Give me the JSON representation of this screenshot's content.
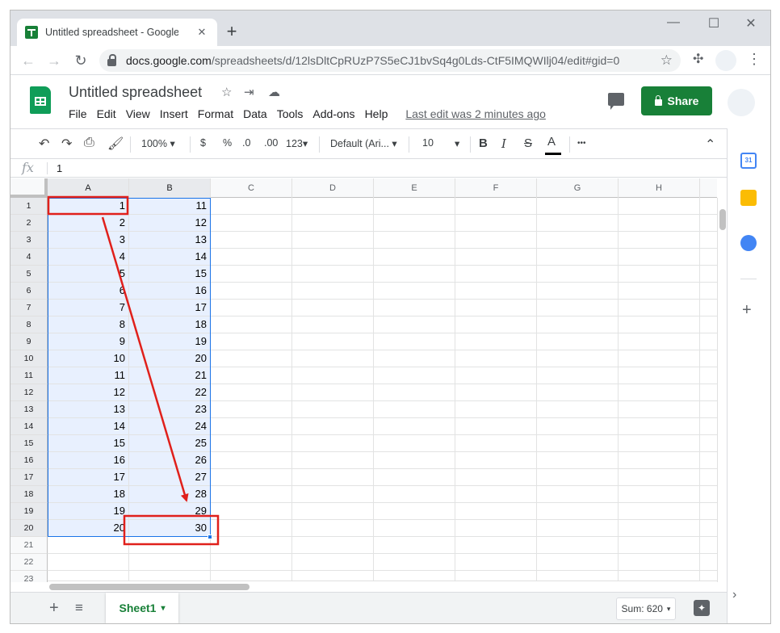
{
  "browser": {
    "tab_title": "Untitled spreadsheet - Google Sheets",
    "tab_close": "✕",
    "new_tab": "+",
    "window_controls": {
      "minimize": "—",
      "maximize": "☐",
      "close": "✕"
    },
    "url_host": "docs.google.com",
    "url_path": "/spreadsheets/d/12lsDltCpRUzP7S5eCJ1bvSq4g0Lds-CtF5IMQWIlj04/edit#gid=0",
    "back": "←",
    "forward": "→",
    "reload": "↻",
    "bookmark": "☆",
    "extensions": "✣",
    "menu": "⋮"
  },
  "app": {
    "doc_title": "Untitled spreadsheet",
    "title_icons": {
      "star": "☆",
      "move": "⇥",
      "cloud": "☁"
    },
    "menu": [
      "File",
      "Edit",
      "View",
      "Insert",
      "Format",
      "Data",
      "Tools",
      "Add-ons",
      "Help"
    ],
    "last_edit": "Last edit was 2 minutes ago",
    "share_label": "Share"
  },
  "toolbar": {
    "undo": "↶",
    "redo": "↷",
    "print": "⎙",
    "paint_format": "🖌",
    "zoom": "100%",
    "caret": "▾",
    "currency": "$",
    "percent": "%",
    "dec_decrease": ".0",
    "dec_increase": ".00",
    "more_formats": "123",
    "font": "Default (Ari...",
    "font_size": "10",
    "bold": "B",
    "italic": "I",
    "strike": "S",
    "text_color": "A",
    "more": "•••",
    "collapse": "⌃"
  },
  "formula_bar": {
    "fx": "fx",
    "value": "1"
  },
  "grid": {
    "columns": [
      "A",
      "B",
      "C",
      "D",
      "E",
      "F",
      "G",
      "H"
    ],
    "rows": [
      "1",
      "2",
      "3",
      "4",
      "5",
      "6",
      "7",
      "8",
      "9",
      "10",
      "11",
      "12",
      "13",
      "14",
      "15",
      "16",
      "17",
      "18",
      "19",
      "20",
      "21",
      "22",
      "23"
    ],
    "col_a": [
      "1",
      "2",
      "3",
      "4",
      "5",
      "6",
      "7",
      "8",
      "9",
      "10",
      "11",
      "12",
      "13",
      "14",
      "15",
      "16",
      "17",
      "18",
      "19",
      "20"
    ],
    "col_b": [
      "11",
      "12",
      "13",
      "14",
      "15",
      "16",
      "17",
      "18",
      "19",
      "20",
      "21",
      "22",
      "23",
      "24",
      "25",
      "26",
      "27",
      "28",
      "29",
      "30"
    ]
  },
  "bottom": {
    "add_sheet": "+",
    "all_sheets": "≡",
    "sheet_name": "Sheet1",
    "caret": "▾",
    "sum_label": "Sum: 620",
    "explore": "✦"
  },
  "side_panel": {
    "calendar": "31",
    "add": "+",
    "toggle": "›"
  },
  "colors": {
    "accent": "#1a73e8",
    "brand_green": "#188038",
    "annotation_red": "#e0201b",
    "selection_fill": "#e8f0fe"
  }
}
